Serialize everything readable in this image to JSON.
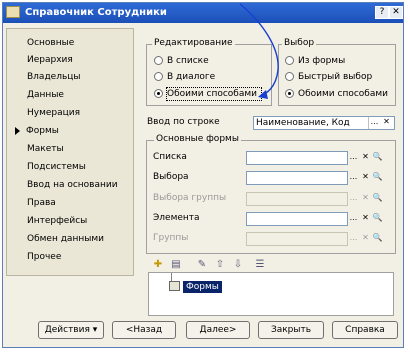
{
  "window": {
    "title": "Справочник Сотрудники",
    "help_btn": "?",
    "close_btn": "✕"
  },
  "sidebar": {
    "items": [
      {
        "label": "Основные"
      },
      {
        "label": "Иерархия"
      },
      {
        "label": "Владельцы"
      },
      {
        "label": "Данные"
      },
      {
        "label": "Нумерация"
      },
      {
        "label": "Формы"
      },
      {
        "label": "Макеты"
      },
      {
        "label": "Подсистемы"
      },
      {
        "label": "Ввод на основании"
      },
      {
        "label": "Права"
      },
      {
        "label": "Интерфейсы"
      },
      {
        "label": "Обмен данными"
      },
      {
        "label": "Прочее"
      }
    ],
    "selected": "Формы"
  },
  "edit_group": {
    "title": "Редактирование",
    "options": [
      "В списке",
      "В диалоге",
      "Обоими способами"
    ],
    "selected": "Обоими способами"
  },
  "choice_group": {
    "title": "Выбор",
    "options": [
      "Из формы",
      "Быстрый выбор",
      "Обоими способами"
    ],
    "selected": "Обоими способами"
  },
  "input_by_string": {
    "label": "Ввод по строке",
    "value": "Наименование, Код",
    "btn": "...",
    "clear": "✕"
  },
  "main_forms": {
    "title": "Основные формы",
    "rows": [
      {
        "label": "Списка",
        "enabled": true
      },
      {
        "label": "Выбора",
        "enabled": true
      },
      {
        "label": "Выбора группы",
        "enabled": false
      },
      {
        "label": "Элемента",
        "enabled": true
      },
      {
        "label": "Группы",
        "enabled": false
      }
    ],
    "btn_dots": "...",
    "btn_clear": "✕",
    "btn_open": "🔍"
  },
  "tree": {
    "node": "Формы"
  },
  "toolbar_icons": [
    "add-form-icon",
    "add-group-icon",
    "edit-icon",
    "move-up-icon",
    "move-down-icon",
    "sort-icon"
  ],
  "buttons": {
    "actions": "Действия",
    "actions_arrow": "▾",
    "back": "<Назад",
    "next": "Далее>",
    "close": "Закрыть",
    "help": "Справка"
  },
  "colors": {
    "title_bar": "#1c4fb8",
    "selection": "#0a246a",
    "arrow": "#1a3fd0"
  }
}
